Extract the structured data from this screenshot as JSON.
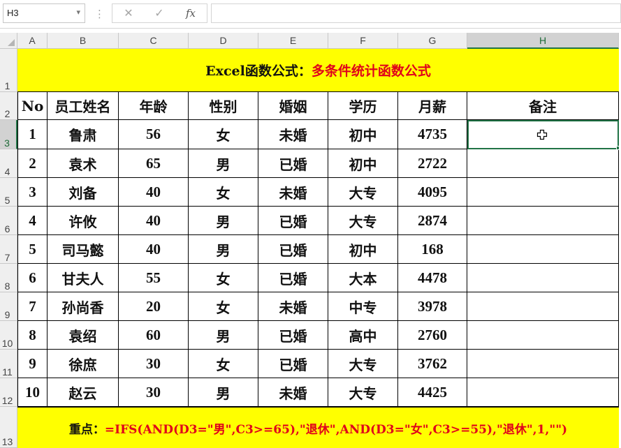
{
  "formula_bar": {
    "name_box": "H3",
    "cancel_icon": "✕",
    "enter_icon": "✓",
    "fx_label": "fx",
    "formula_value": ""
  },
  "columns": [
    "A",
    "B",
    "C",
    "D",
    "E",
    "F",
    "G",
    "H"
  ],
  "selected_column": "H",
  "rows": [
    "1",
    "2",
    "3",
    "4",
    "5",
    "6",
    "7",
    "8",
    "9",
    "10",
    "11",
    "12",
    "13"
  ],
  "selected_row": "3",
  "title": {
    "black_part": "Excel函数公式：",
    "red_part": "多条件统计函数公式"
  },
  "table": {
    "headers": [
      "No",
      "员工姓名",
      "年龄",
      "性别",
      "婚姻",
      "学历",
      "月薪",
      "备注"
    ],
    "rows": [
      [
        "1",
        "鲁肃",
        "56",
        "女",
        "未婚",
        "初中",
        "4735",
        ""
      ],
      [
        "2",
        "袁术",
        "65",
        "男",
        "已婚",
        "初中",
        "2722",
        ""
      ],
      [
        "3",
        "刘备",
        "40",
        "女",
        "未婚",
        "大专",
        "4095",
        ""
      ],
      [
        "4",
        "许攸",
        "40",
        "男",
        "已婚",
        "大专",
        "2874",
        ""
      ],
      [
        "5",
        "司马懿",
        "40",
        "男",
        "已婚",
        "初中",
        "168",
        ""
      ],
      [
        "6",
        "甘夫人",
        "55",
        "女",
        "已婚",
        "大本",
        "4478",
        ""
      ],
      [
        "7",
        "孙尚香",
        "20",
        "女",
        "未婚",
        "中专",
        "3978",
        ""
      ],
      [
        "8",
        "袁绍",
        "60",
        "男",
        "已婚",
        "高中",
        "2760",
        ""
      ],
      [
        "9",
        "徐庶",
        "30",
        "女",
        "已婚",
        "大专",
        "3762",
        ""
      ],
      [
        "10",
        "赵云",
        "30",
        "男",
        "未婚",
        "大专",
        "4425",
        ""
      ]
    ]
  },
  "note": {
    "label": "重点：",
    "formula": "=IFS(AND(D3=\"男\",C3>=65),\"退休\",AND(D3=\"女\",C3>=55),\"退休\",1,\"\")"
  },
  "colors": {
    "highlight": "#ffff00",
    "red_text": "#e0001b",
    "selection": "#217346"
  }
}
